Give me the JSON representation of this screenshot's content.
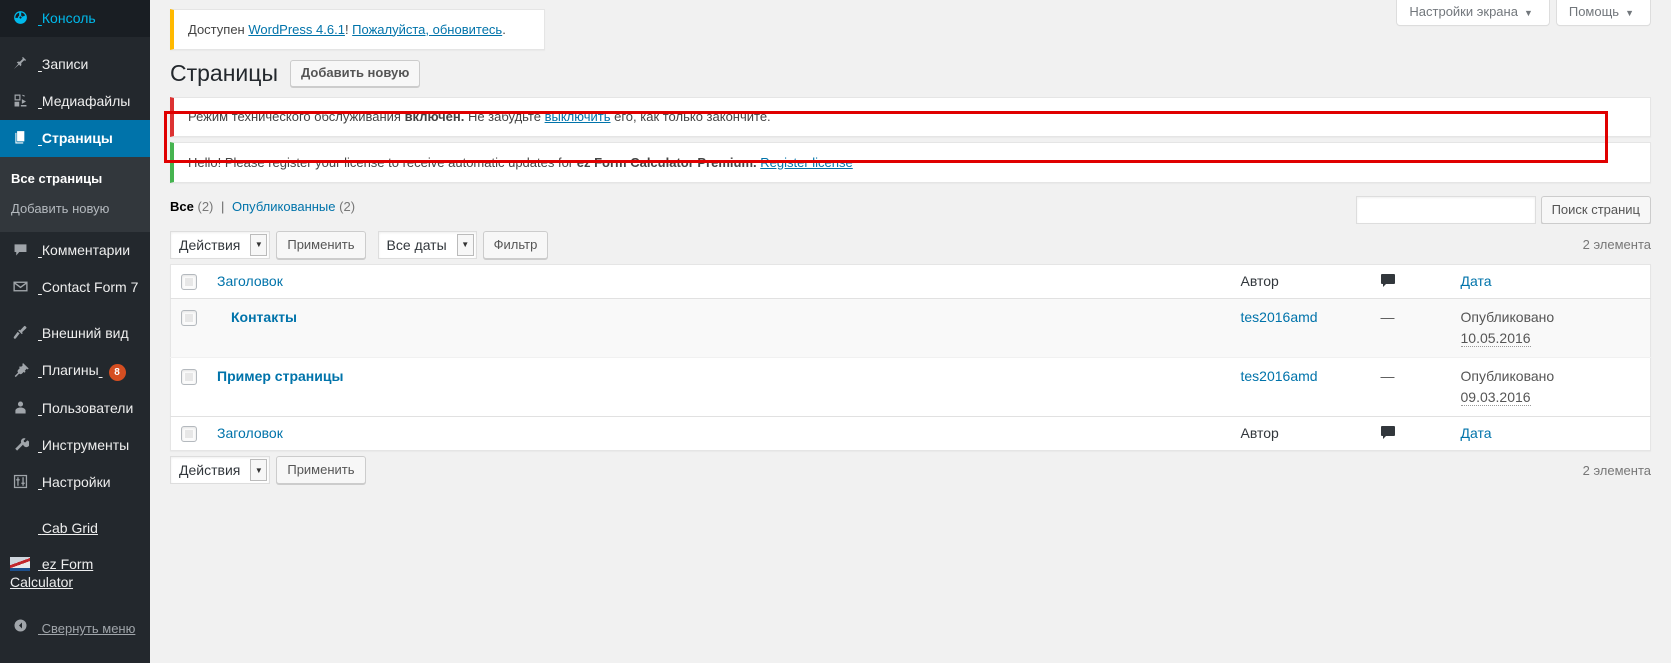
{
  "sidebar": {
    "items": [
      {
        "label": "Консоль",
        "icon": "dashboard-icon",
        "name": "sidebar-item-dashboard"
      },
      {
        "label": "Записи",
        "icon": "pin-icon",
        "name": "sidebar-item-posts"
      },
      {
        "label": "Медиафайлы",
        "icon": "media-icon",
        "name": "sidebar-item-media"
      },
      {
        "label": "Страницы",
        "icon": "pages-icon",
        "name": "sidebar-item-pages",
        "current": true
      },
      {
        "label": "Комментарии",
        "icon": "comment-icon",
        "name": "sidebar-item-comments"
      },
      {
        "label": "Contact Form 7",
        "icon": "envelope-icon",
        "name": "sidebar-item-contact-form-7"
      },
      {
        "label": "Внешний вид",
        "icon": "appearance-icon",
        "name": "sidebar-item-appearance"
      },
      {
        "label": "Плагины",
        "icon": "plugin-icon",
        "name": "sidebar-item-plugins",
        "badge": "8"
      },
      {
        "label": "Пользователи",
        "icon": "user-icon",
        "name": "sidebar-item-users"
      },
      {
        "label": "Инструменты",
        "icon": "wrench-icon",
        "name": "sidebar-item-tools"
      },
      {
        "label": "Настройки",
        "icon": "settings-icon",
        "name": "sidebar-item-settings"
      }
    ],
    "submenu": {
      "all_pages": "Все страницы",
      "add_new": "Добавить новую"
    },
    "plugin_items": [
      {
        "label": "Cab Grid",
        "name": "sidebar-item-cab-grid",
        "icon": "none"
      },
      {
        "label": "ez Form Calculator",
        "name": "sidebar-item-ez-form-calculator",
        "icon": "ez-form-calculator-icon"
      }
    ],
    "collapse_label": "Свернуть меню",
    "badge_color": "#d54e21",
    "accent_color": "#0073aa"
  },
  "screen_meta": {
    "screen_options": "Настройки экрана",
    "help": "Помощь",
    "caret": "▼"
  },
  "notices": {
    "update": {
      "prefix": "Доступен ",
      "link_version": "WordPress 4.6.1",
      "mid": "! ",
      "link_update": "Пожалуйста, обновитесь",
      "suffix": ".",
      "accent": "#ffb900"
    },
    "maintenance": {
      "text_1": "Режим технического обслуживания ",
      "bold": "включён.",
      "text_2": " Не забудьте ",
      "link": "выключить",
      "text_3": " его, как только закончите.",
      "accent": "#dc3232"
    },
    "license": {
      "text_1": "Hello! Please register your license to receive automatic updates for ",
      "bold": "ez Form Calculator Premium.",
      "link": "Register license",
      "accent": "#46b450"
    }
  },
  "annotation": {
    "color": "#e00000"
  },
  "page": {
    "title": "Страницы",
    "add_new": "Добавить новую"
  },
  "views": {
    "all": {
      "label": "Все",
      "count": "(2)"
    },
    "separator": "|",
    "published": {
      "label": "Опубликованные",
      "count": "(2)"
    }
  },
  "search": {
    "value": "",
    "placeholder": "",
    "button": "Поиск страниц"
  },
  "tablenav": {
    "bulk_actions": "Действия",
    "apply": "Применить",
    "dates": "Все даты",
    "filter": "Фильтр",
    "count_top": "2 элемента",
    "count_bottom": "2 элемента",
    "arrow": "▼"
  },
  "table": {
    "columns": {
      "title": "Заголовок",
      "author": "Автор",
      "comments": "comment-bubble-icon",
      "date": "Дата"
    },
    "rows": [
      {
        "title": "Контакты",
        "indent": true,
        "author": "tes2016amd",
        "comments": "—",
        "date_status": "Опубликовано",
        "date_value": "10.05.2016"
      },
      {
        "title": "Пример страницы",
        "indent": false,
        "author": "tes2016amd",
        "comments": "—",
        "date_status": "Опубликовано",
        "date_value": "09.03.2016"
      }
    ]
  }
}
